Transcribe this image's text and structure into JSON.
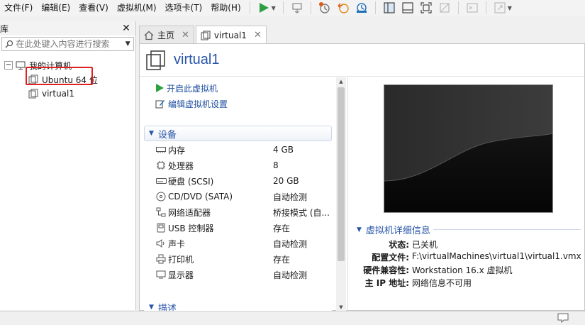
{
  "menu": [
    "文件(F)",
    "编辑(E)",
    "查看(V)",
    "虚拟机(M)",
    "选项卡(T)",
    "帮助(H)"
  ],
  "library": {
    "title": "库",
    "search_placeholder": "在此处键入内容进行搜索",
    "root": "我的计算机",
    "vms": [
      "Ubuntu 64 位",
      "virtual1"
    ]
  },
  "tabs": [
    {
      "label": "主页"
    },
    {
      "label": "virtual1"
    }
  ],
  "vm": {
    "title": "virtual1",
    "actions": [
      "开启此虚拟机",
      "编辑虚拟机设置"
    ],
    "devices_header": "设备",
    "devices": [
      {
        "icon": "memory-icon",
        "name": "内存",
        "value": "4 GB"
      },
      {
        "icon": "processor-icon",
        "name": "处理器",
        "value": "8"
      },
      {
        "icon": "disk-icon",
        "name": "硬盘 (SCSI)",
        "value": "20 GB"
      },
      {
        "icon": "cd-icon",
        "name": "CD/DVD (SATA)",
        "value": "自动检测"
      },
      {
        "icon": "network-icon",
        "name": "网络适配器",
        "value": "桥接模式 (自..."
      },
      {
        "icon": "usb-icon",
        "name": "USB 控制器",
        "value": "存在"
      },
      {
        "icon": "sound-icon",
        "name": "声卡",
        "value": "自动检测"
      },
      {
        "icon": "printer-icon",
        "name": "打印机",
        "value": "存在"
      },
      {
        "icon": "display-icon",
        "name": "显示器",
        "value": "自动检测"
      }
    ],
    "description_header": "描述",
    "details_header": "虚拟机详细信息",
    "details": [
      {
        "key": "状态:",
        "value": "已关机"
      },
      {
        "key": "配置文件:",
        "value": "F:\\virtualMachines\\virtual1\\virtual1.vmx"
      },
      {
        "key": "硬件兼容性:",
        "value": "Workstation 16.x 虚拟机"
      },
      {
        "key": "主 IP 地址:",
        "value": "网络信息不可用"
      }
    ]
  },
  "colors": {
    "accent": "#2855a8",
    "play": "#2ea043",
    "selection_outline": "#e02020"
  }
}
